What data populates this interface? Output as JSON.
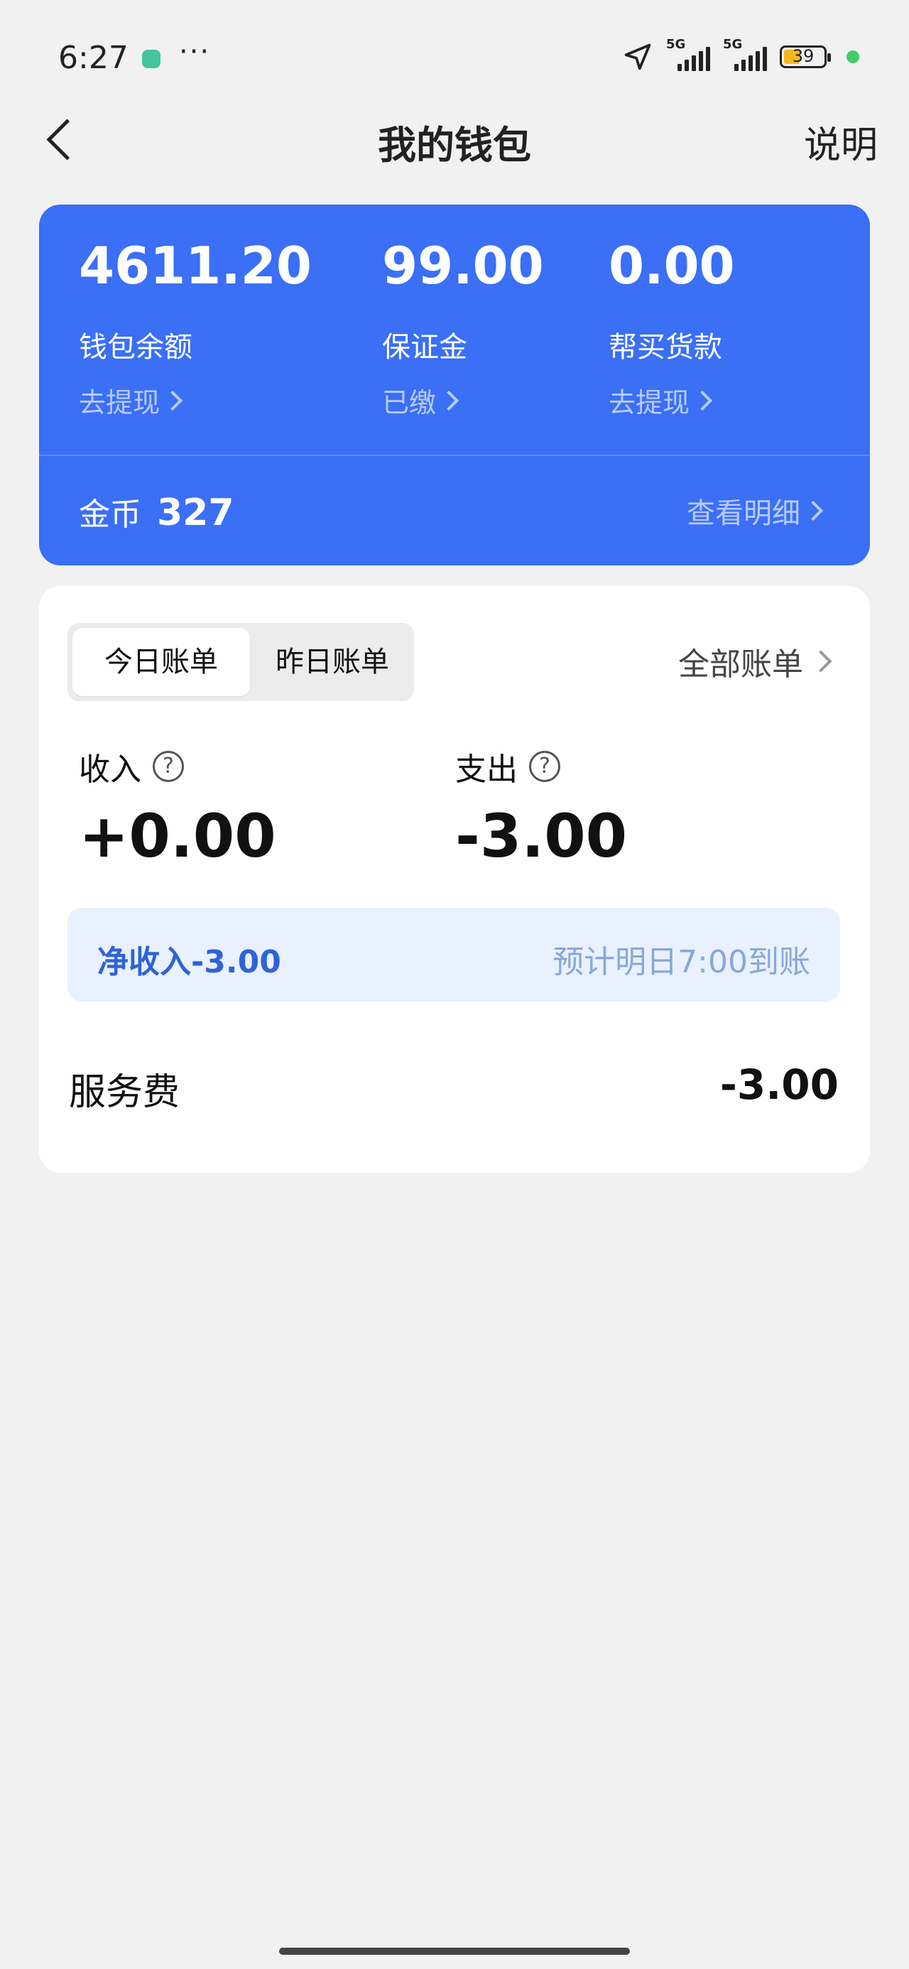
{
  "status_bar": {
    "time": "6:27",
    "more": "···",
    "signal_1": "5G",
    "signal_2": "5G",
    "battery": "39"
  },
  "nav": {
    "title": "我的钱包",
    "right_label": "说明"
  },
  "wallet": {
    "balance": {
      "amount": "4611.20",
      "label": "钱包余额",
      "link": "去提现"
    },
    "deposit": {
      "amount": "99.00",
      "label": "保证金",
      "link": "已缴"
    },
    "purchase": {
      "amount": "0.00",
      "label": "帮买货款",
      "link": "去提现"
    },
    "coins_label": "金币",
    "coins_value": "327",
    "coins_detail": "查看明细"
  },
  "bill": {
    "tabs": [
      "今日账单",
      "昨日账单"
    ],
    "active_tab": "今日账单",
    "all_bills": "全部账单",
    "income_label": "收入",
    "income_value": "+0.00",
    "expense_label": "支出",
    "expense_value": "-3.00",
    "net_label": "净收入-3.00",
    "eta": "预计明日7:00到账",
    "items": [
      {
        "label": "服务费",
        "value": "-3.00"
      }
    ]
  },
  "colors": {
    "card_blue": "#3a6ff6",
    "net_bg": "#e8f1fd",
    "net_text": "#2f63d6"
  }
}
